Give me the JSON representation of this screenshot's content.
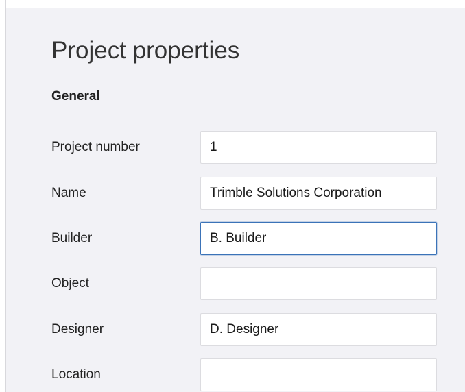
{
  "page": {
    "title": "Project properties",
    "section": "General"
  },
  "fields": [
    {
      "label": "Project number",
      "value": "1"
    },
    {
      "label": "Name",
      "value": "Trimble Solutions Corporation"
    },
    {
      "label": "Builder",
      "value": "B. Builder"
    },
    {
      "label": "Object",
      "value": ""
    },
    {
      "label": "Designer",
      "value": "D. Designer"
    },
    {
      "label": "Location",
      "value": ""
    }
  ],
  "colors": {
    "panel_background": "#f2f2f6",
    "focus_border": "#3b73b8"
  }
}
